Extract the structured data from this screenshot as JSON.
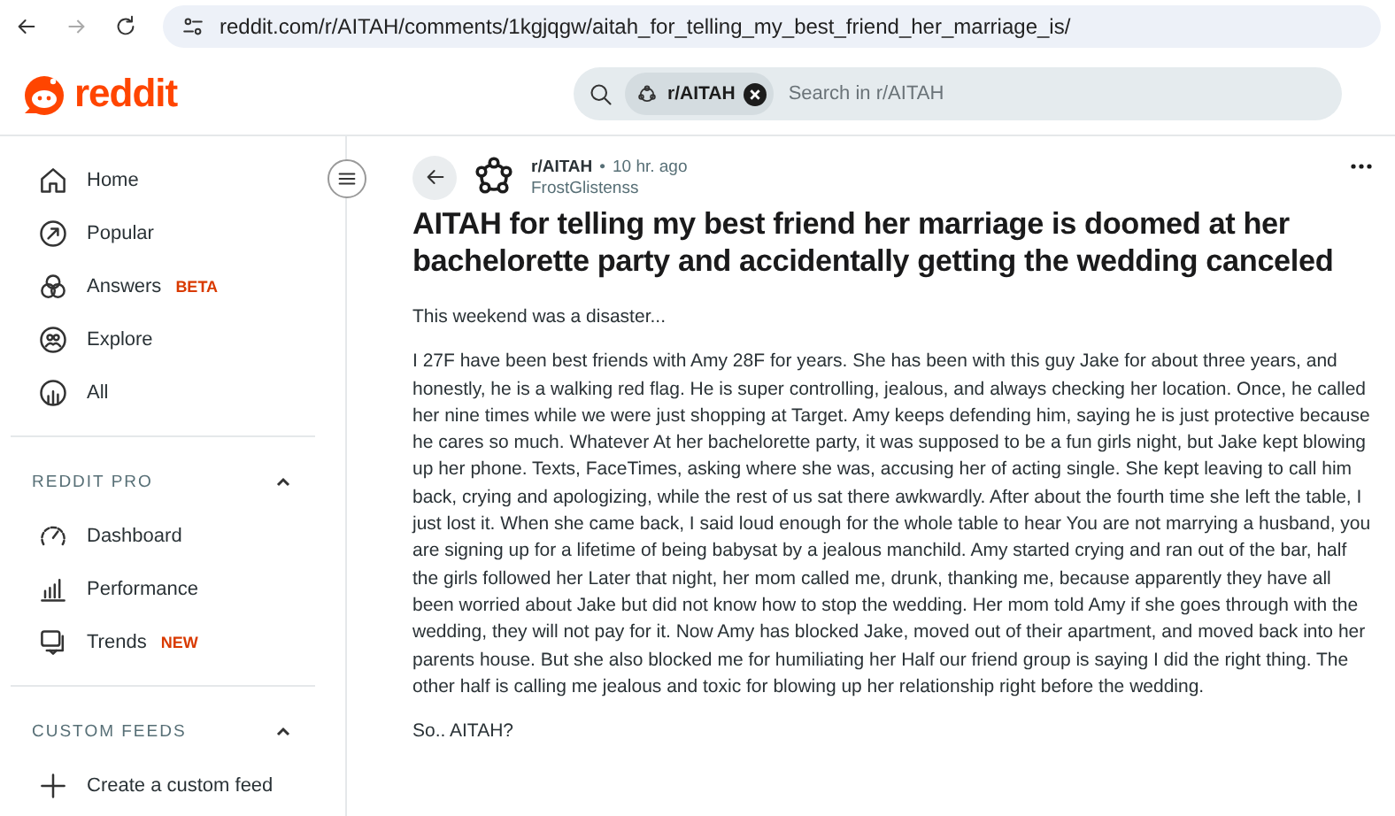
{
  "browser": {
    "url": "reddit.com/r/AITAH/comments/1kgjqgw/aitah_for_telling_my_best_friend_her_marriage_is/"
  },
  "header": {
    "logo": "reddit",
    "search": {
      "chip": "r/AITAH",
      "placeholder": "Search in r/AITAH"
    }
  },
  "sidebar": {
    "items": [
      {
        "kind": "home",
        "label": "Home"
      },
      {
        "kind": "popular",
        "label": "Popular"
      },
      {
        "kind": "answers",
        "label": "Answers",
        "badge": "BETA"
      },
      {
        "kind": "explore",
        "label": "Explore"
      },
      {
        "kind": "all",
        "label": "All"
      }
    ],
    "sections": [
      {
        "title": "REDDIT PRO",
        "expanded": true,
        "items": [
          {
            "kind": "dashboard",
            "label": "Dashboard"
          },
          {
            "kind": "performance",
            "label": "Performance"
          },
          {
            "kind": "trends",
            "label": "Trends",
            "badge": "NEW"
          }
        ]
      },
      {
        "title": "CUSTOM FEEDS",
        "expanded": true,
        "items": [
          {
            "kind": "plus",
            "label": "Create a custom feed"
          }
        ]
      }
    ]
  },
  "post": {
    "subreddit": "r/AITAH",
    "separator": "•",
    "time": "10 hr. ago",
    "author": "FrostGlistenss",
    "title": "AITAH for telling my best friend her marriage is doomed at her bachelorette party and accidentally getting the wedding canceled",
    "paragraphs": [
      "This weekend was a disaster...",
      "I 27F have been best friends with Amy 28F for years. She has been with this guy Jake for about three years, and honestly, he is a walking red flag. He is super controlling, jealous, and always checking her location. Once, he called her nine times while we were just shopping at Target. Amy keeps defending him, saying he is just protective because he cares so much. Whatever At her bachelorette party, it was supposed to be a fun girls night, but Jake kept blowing up her phone. Texts, FaceTimes, asking where she was, accusing her of acting single. She kept leaving to call him back, crying and apologizing, while the rest of us sat there awkwardly. After about the fourth time she left the table, I just lost it. When she came back, I said loud enough for the whole table to hear You are not marrying a husband, you are signing up for a lifetime of being babysat by a jealous manchild. Amy started crying and ran out of the bar, half the girls followed her Later that night, her mom called me, drunk, thanking me, because apparently they have all been worried about Jake but did not know how to stop the wedding. Her mom told Amy if she goes through with the wedding, they will not pay for it. Now Amy has blocked Jake, moved out of their apartment, and moved back into her parents house. But she also blocked me for humiliating her Half our friend group is saying I did the right thing. The other half is calling me jealous and toxic for blowing up her relationship right before the wedding.",
      "So.. AITAH?"
    ]
  }
}
